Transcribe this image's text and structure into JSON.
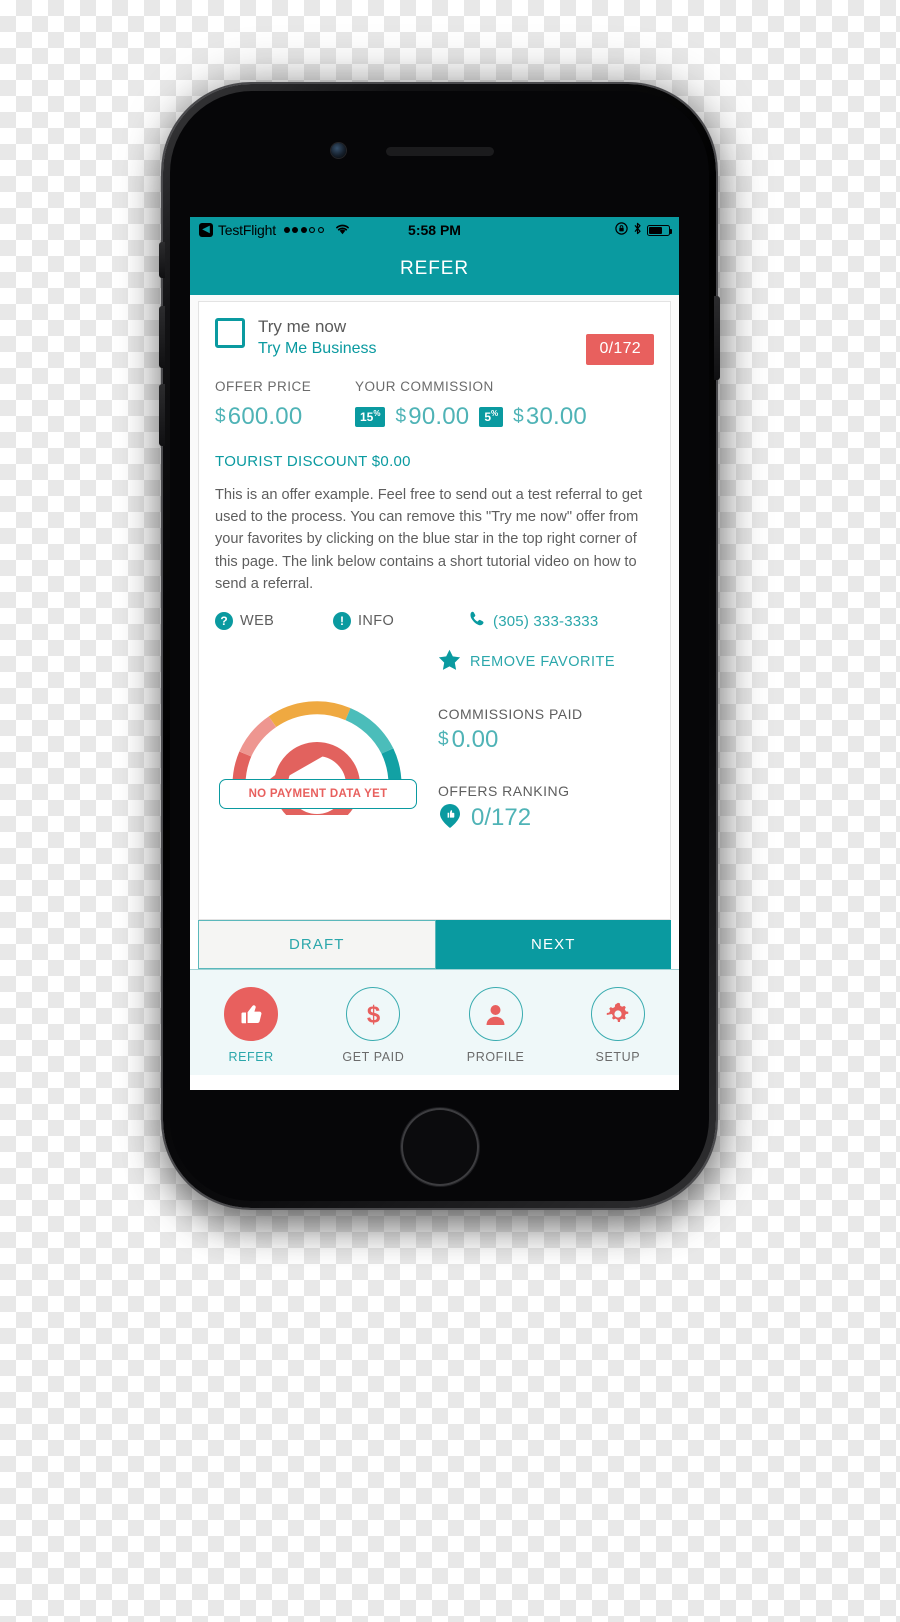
{
  "status_bar": {
    "back_glyph": "◀",
    "app_name": "TestFlight",
    "signal_dots_filled": 3,
    "signal_dots_total": 5,
    "wifi_icon": "wifi-icon",
    "time": "5:58 PM",
    "lock_rotation_icon": "rotation-lock-icon",
    "bluetooth_icon": "bluetooth-icon",
    "battery_icon": "battery-icon",
    "battery_level_pct": 64
  },
  "navbar": {
    "title": "REFER"
  },
  "offer": {
    "checkbox_checked": false,
    "title": "Try me now",
    "business": "Try Me Business",
    "count_badge": "0/172",
    "offer_price_label": "OFFER PRICE",
    "offer_price_currency": "$",
    "offer_price_value": "600.00",
    "commission_label": "YOUR COMMISSION",
    "commissions": [
      {
        "pct": "15",
        "pct_symbol": "%",
        "currency": "$",
        "value": "90.00"
      },
      {
        "pct": "5",
        "pct_symbol": "%",
        "currency": "$",
        "value": "30.00"
      }
    ],
    "tourist_discount": "TOURIST DISCOUNT $0.00",
    "description": "This is an offer example. Feel free to send out a test referral to get used to the process. You can remove this \"Try me now\" offer from your favorites by clicking on the blue star in the top right corner of this page. The link below contains a short tutorial video on how to send a referral.",
    "links": [
      {
        "icon": "question-circle-icon",
        "glyph": "?",
        "label": "WEB"
      },
      {
        "icon": "exclamation-circle-icon",
        "glyph": "!",
        "label": "INFO"
      }
    ],
    "phone_icon": "phone-handset-icon",
    "phone_number": "(305) 333-3333"
  },
  "favorite": {
    "icon": "star-icon",
    "label": "REMOVE FAVORITE"
  },
  "gauge": {
    "empty_label": "NO PAYMENT DATA YET",
    "needle_icon": "gauge-needle-icon",
    "segments": [
      {
        "name": "critical",
        "color": "#e2625e"
      },
      {
        "name": "low",
        "color": "#ee9690"
      },
      {
        "name": "medium",
        "color": "#efa941"
      },
      {
        "name": "good",
        "color": "#4bbdba"
      },
      {
        "name": "best",
        "color": "#12a1a4"
      }
    ]
  },
  "stats": [
    {
      "label": "COMMISSIONS PAID",
      "currency": "$",
      "value": "0.00",
      "icon": null
    },
    {
      "label": "OFFERS RANKING",
      "currency": "",
      "value": "0/172",
      "icon": "location-pin-thumb-icon"
    }
  ],
  "actions": {
    "draft_label": "DRAFT",
    "next_label": "NEXT"
  },
  "tabbar": {
    "items": [
      {
        "icon": "thumbs-up-icon",
        "glyph": "👍",
        "label": "REFER",
        "active": true
      },
      {
        "icon": "dollar-icon",
        "glyph": "$",
        "label": "GET PAID",
        "active": false
      },
      {
        "icon": "person-icon",
        "glyph": "person",
        "label": "PROFILE",
        "active": false
      },
      {
        "icon": "gear-icon",
        "glyph": "gear",
        "label": "SETUP",
        "active": false
      }
    ]
  },
  "colors": {
    "teal": "#0a9aa0",
    "teal_light": "#4fb3b6",
    "red": "#e8605e",
    "grey_text": "#5e5e5e"
  }
}
